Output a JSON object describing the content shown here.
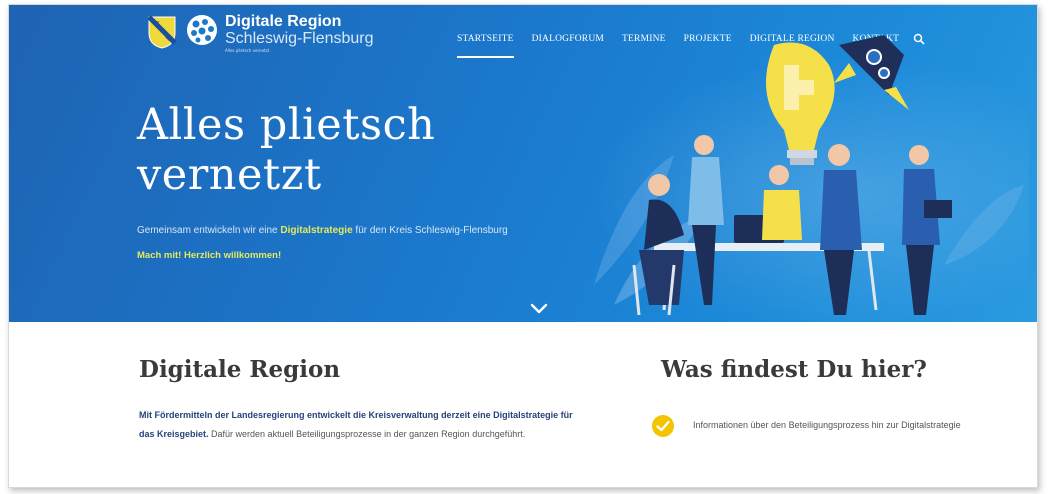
{
  "brand": {
    "title": "Digitale Region",
    "subtitle": "Schleswig-Flensburg",
    "tagline": "Alles plietsch vernetzt"
  },
  "nav": {
    "items": [
      "STARTSEITE",
      "DIALOGFORUM",
      "TERMINE",
      "PROJEKTE",
      "DIGITALE REGION",
      "KONTAKT"
    ],
    "active_index": 0,
    "search_icon": "search-icon"
  },
  "hero": {
    "headline_line1": "Alles plietsch",
    "headline_line2": "vernetzt",
    "subline_before": "Gemeinsam entwickeln wir eine ",
    "subline_highlight": "Digitalstrategie",
    "subline_after": " für den Kreis Schleswig-Flensburg",
    "cta": "Mach mit! Herzlich willkommen!",
    "scroll_icon": "chevron-down-icon"
  },
  "section": {
    "title": "Digitale Region",
    "text_bold": "Mit Fördermitteln der Landesregierung entwickelt die Kreisverwaltung derzeit eine Digitalstrategie für das Kreisgebiet.",
    "text_rest": " Dafür werden aktuell Beteiligungsprozesse in der ganzen Region durchgeführt."
  },
  "aside": {
    "title": "Was findest Du hier?",
    "items": [
      "Informationen über den Beteiligungsprozess hin zur Digitalstrategie"
    ],
    "check_icon": "check-circle-icon"
  },
  "colors": {
    "hero_blue": "#1b78cc",
    "accent_yellow": "#e7e95c",
    "check_yellow": "#f2c500",
    "dark_text": "#3a3a3a"
  }
}
